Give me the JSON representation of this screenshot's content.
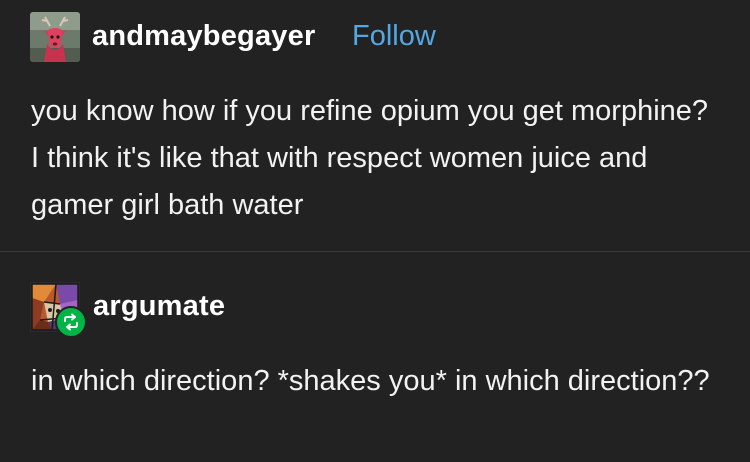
{
  "posts": [
    {
      "username": "andmaybegayer",
      "follow_label": "Follow",
      "body": "you know how if you refine opium you get morphine? I think it's like that with respect women juice and gamer girl bath water"
    },
    {
      "username": "argumate",
      "body": "in which direction? *shakes you* in which direction??"
    }
  ],
  "colors": {
    "background": "#222222",
    "follow_link": "#53a7e2",
    "reblog_badge": "#00b448"
  },
  "icons": {
    "reblog": "reblog-icon"
  }
}
